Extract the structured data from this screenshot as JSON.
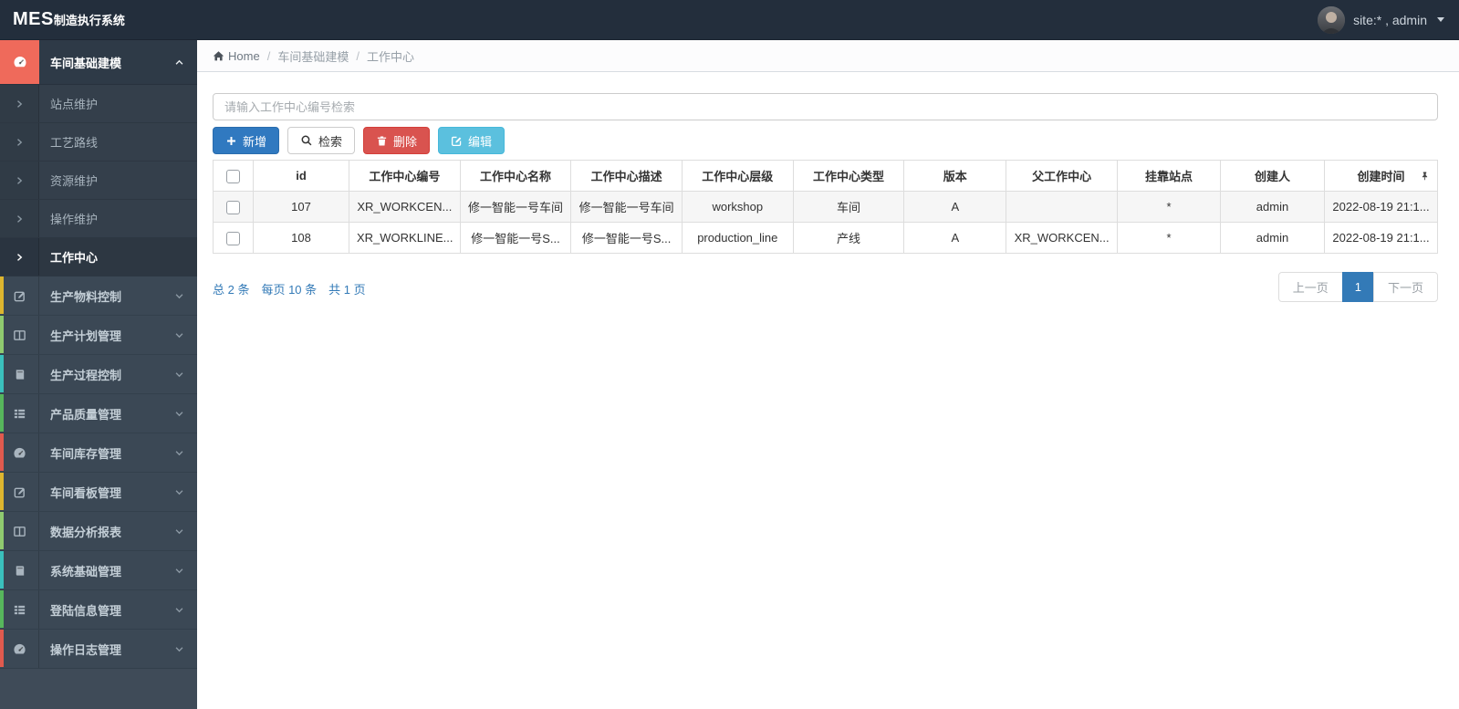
{
  "topbar": {
    "brand_primary": "MES",
    "brand_secondary": "制造执行系统",
    "user_label": "site:* , admin"
  },
  "breadcrumb": {
    "home_label": "Home",
    "separator": "/",
    "section_label": "车间基础建模",
    "page_label": "工作中心"
  },
  "sidebar": {
    "items": [
      {
        "label": "车间基础建模",
        "icon": "dashboard-icon",
        "type": "section",
        "state": "open",
        "strip": "#ef6a5b"
      },
      {
        "label": "站点维护",
        "icon": "chevron-right-icon",
        "type": "sub"
      },
      {
        "label": "工艺路线",
        "icon": "chevron-right-icon",
        "type": "sub"
      },
      {
        "label": "资源维护",
        "icon": "chevron-right-icon",
        "type": "sub"
      },
      {
        "label": "操作维护",
        "icon": "chevron-right-icon",
        "type": "sub"
      },
      {
        "label": "工作中心",
        "icon": "chevron-right-icon",
        "type": "sub",
        "state": "active"
      },
      {
        "label": "生产物料控制",
        "icon": "edit-square-icon",
        "strip": "#ddb52f"
      },
      {
        "label": "生产计划管理",
        "icon": "columns-icon",
        "strip": "#8fca6f"
      },
      {
        "label": "生产过程控制",
        "icon": "book-icon",
        "strip": "#3ac0bc"
      },
      {
        "label": "产品质量管理",
        "icon": "list-icon",
        "strip": "#57b65c"
      },
      {
        "label": "车间库存管理",
        "icon": "dashboard-icon",
        "strip": "#e05a4e"
      },
      {
        "label": "车间看板管理",
        "icon": "edit-square-icon",
        "strip": "#ddb52f"
      },
      {
        "label": "数据分析报表",
        "icon": "columns-icon",
        "strip": "#8fca6f"
      },
      {
        "label": "系统基础管理",
        "icon": "book-icon",
        "strip": "#3ac0bc"
      },
      {
        "label": "登陆信息管理",
        "icon": "list-icon",
        "strip": "#57b65c"
      },
      {
        "label": "操作日志管理",
        "icon": "dashboard-icon",
        "strip": "#e05a4e"
      }
    ]
  },
  "search": {
    "placeholder": "请输入工作中心编号检索",
    "value": ""
  },
  "toolbar": {
    "add_label": "新增",
    "search_label": "检索",
    "delete_label": "删除",
    "edit_label": "编辑"
  },
  "table": {
    "columns": [
      "id",
      "工作中心编号",
      "工作中心名称",
      "工作中心描述",
      "工作中心层级",
      "工作中心类型",
      "版本",
      "父工作中心",
      "挂靠站点",
      "创建人",
      "创建时间"
    ],
    "rows": [
      {
        "cells": [
          "107",
          "XR_WORKCEN...",
          "修一智能一号车间",
          "修一智能一号车间",
          "workshop",
          "车间",
          "A",
          "",
          "*",
          "admin",
          "2022-08-19 21:1..."
        ]
      },
      {
        "cells": [
          "108",
          "XR_WORKLINE...",
          "修一智能一号S...",
          "修一智能一号S...",
          "production_line",
          "产线",
          "A",
          "XR_WORKCEN...",
          "*",
          "admin",
          "2022-08-19 21:1..."
        ]
      }
    ]
  },
  "pagination": {
    "total_label": "总 2 条",
    "per_page_label": "每页 10 条",
    "pages_label": "共 1 页",
    "prev_label": "上一页",
    "current_page": "1",
    "next_label": "下一页"
  },
  "colors": {
    "topbar_bg": "#232e3c",
    "sidebar_bg": "#3b4855",
    "accent_coral": "#ef6a5b",
    "primary_blue": "#3079c0",
    "danger_red": "#d9534f",
    "info_cyan": "#5bc0de",
    "link_blue": "#337ab7",
    "strip_colors": [
      "#ddb52f",
      "#8fca6f",
      "#3ac0bc",
      "#57b65c",
      "#e05a4e"
    ]
  }
}
